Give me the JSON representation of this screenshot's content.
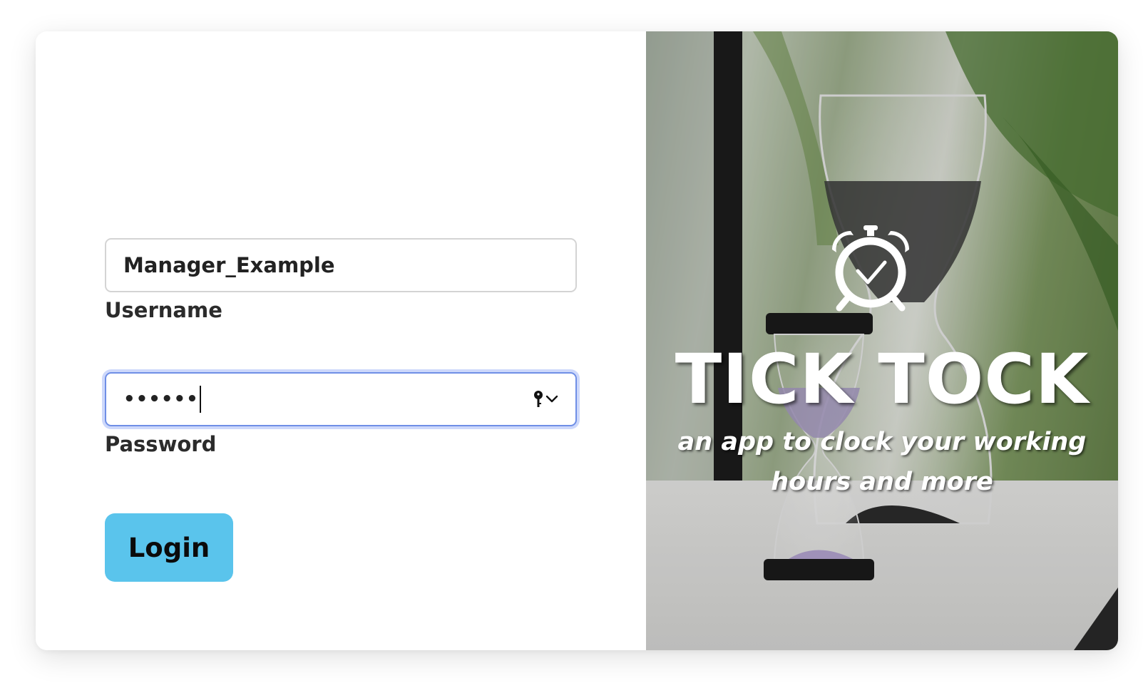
{
  "login_form": {
    "username": {
      "value": "Manager_Example",
      "label": "Username"
    },
    "password": {
      "masked_value": "••••••",
      "label": "Password"
    },
    "login_label": "Login"
  },
  "brand": {
    "title": "TICK TOCK",
    "tagline": "an app to clock your working hours and more",
    "logo_icon": "alarm-clock-icon"
  },
  "colors": {
    "accent": "#5ac4ec",
    "focus_ring": "#6f8fe6"
  }
}
